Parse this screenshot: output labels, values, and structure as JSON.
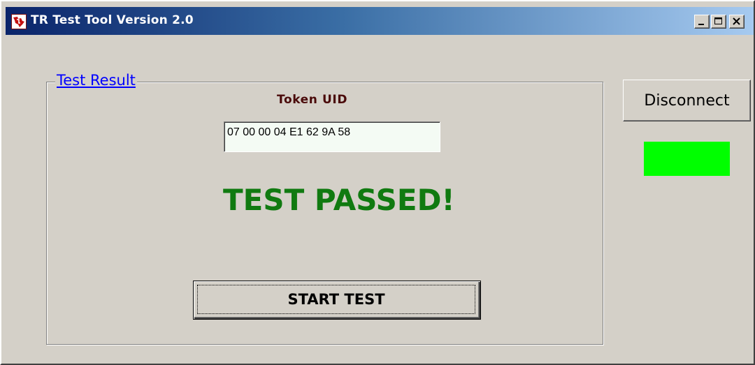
{
  "window": {
    "title": "TR Test Tool Version 2.0",
    "app_icon": "ti-logo-icon",
    "controls": {
      "minimize_icon": "minimize-icon",
      "maximize_icon": "maximize-icon",
      "close_icon": "close-icon"
    }
  },
  "test_result": {
    "group_label": "Test Result",
    "token_uid_label": "Token UID",
    "token_uid_value": "07 00 00 04 E1 62 9A 58",
    "status_text": "TEST PASSED!",
    "status_color": "#107a10",
    "start_button_label": "START TEST"
  },
  "connection": {
    "disconnect_label": "Disconnect",
    "indicator_color": "#00ff00"
  }
}
